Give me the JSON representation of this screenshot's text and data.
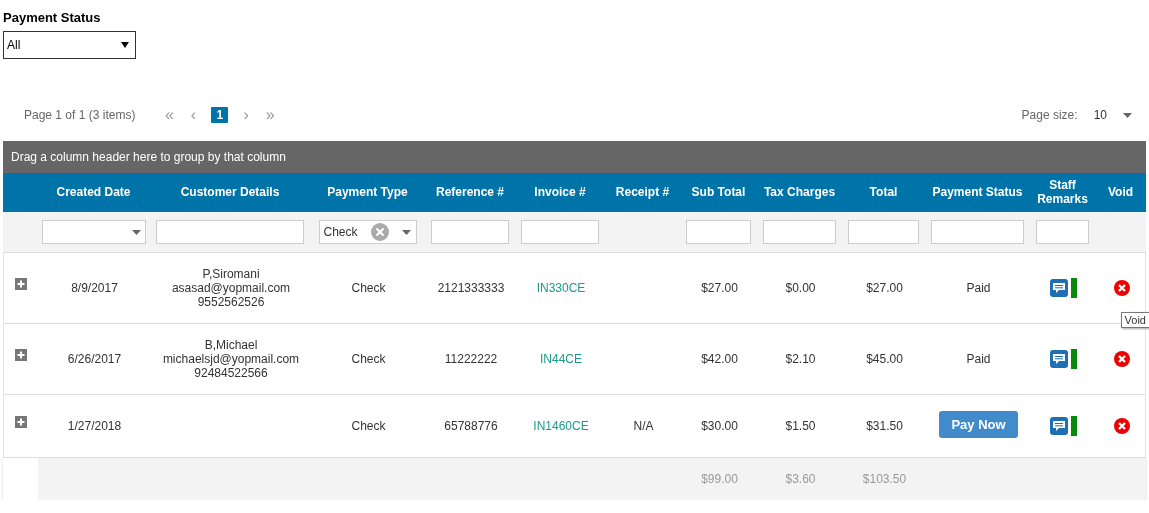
{
  "filter": {
    "label": "Payment Status",
    "value": "All"
  },
  "pager": {
    "summary": "Page 1 of 1 (3 items)",
    "first": "«",
    "prev": "‹",
    "next": "›",
    "last": "»",
    "pages": [
      {
        "label": "1",
        "selected": true
      }
    ],
    "page_size_label": "Page size:",
    "page_size": "10"
  },
  "group_bar": "Drag a column header here to group by that column",
  "columns": [
    "Created Date",
    "Customer Details",
    "Payment Type",
    "Reference #",
    "Invoice #",
    "Receipt #",
    "Sub Total",
    "Tax Charges",
    "Total",
    "Payment Status",
    "Staff Remarks",
    "Void"
  ],
  "filters": [
    {
      "kind": "dropdown"
    },
    {
      "kind": "text"
    },
    {
      "kind": "combo",
      "value": "Check"
    },
    {
      "kind": "text"
    },
    {
      "kind": "text"
    },
    {
      "kind": "none"
    },
    {
      "kind": "text"
    },
    {
      "kind": "text"
    },
    {
      "kind": "text"
    },
    {
      "kind": "text"
    },
    {
      "kind": "text"
    },
    {
      "kind": "none"
    }
  ],
  "rows": [
    {
      "created": "8/9/2017",
      "customer": [
        "P,Siromani",
        "asasad@yopmail.com",
        "9552562526"
      ],
      "payment_type": "Check",
      "reference": "2121333333",
      "invoice": "IN330CE",
      "receipt": "",
      "sub_total": "$27.00",
      "tax": "$0.00",
      "total": "$27.00",
      "status": {
        "kind": "text",
        "label": "Paid"
      }
    },
    {
      "created": "6/26/2017",
      "customer": [
        "B,Michael",
        "michaelsjd@yopmail.com",
        "92484522566"
      ],
      "payment_type": "Check",
      "reference": "11222222",
      "invoice": "IN44CE",
      "receipt": "",
      "sub_total": "$42.00",
      "tax": "$2.10",
      "total": "$45.00",
      "status": {
        "kind": "text",
        "label": "Paid"
      }
    },
    {
      "created": "1/27/2018",
      "customer": [],
      "payment_type": "Check",
      "reference": "65788776",
      "invoice": "IN1460CE",
      "receipt": "N/A",
      "sub_total": "$30.00",
      "tax": "$1.50",
      "total": "$31.50",
      "status": {
        "kind": "button",
        "label": "Pay Now"
      }
    }
  ],
  "totals": {
    "sub_total": "$99.00",
    "tax": "$3.60",
    "total": "$103.50"
  },
  "tooltip": "Void"
}
